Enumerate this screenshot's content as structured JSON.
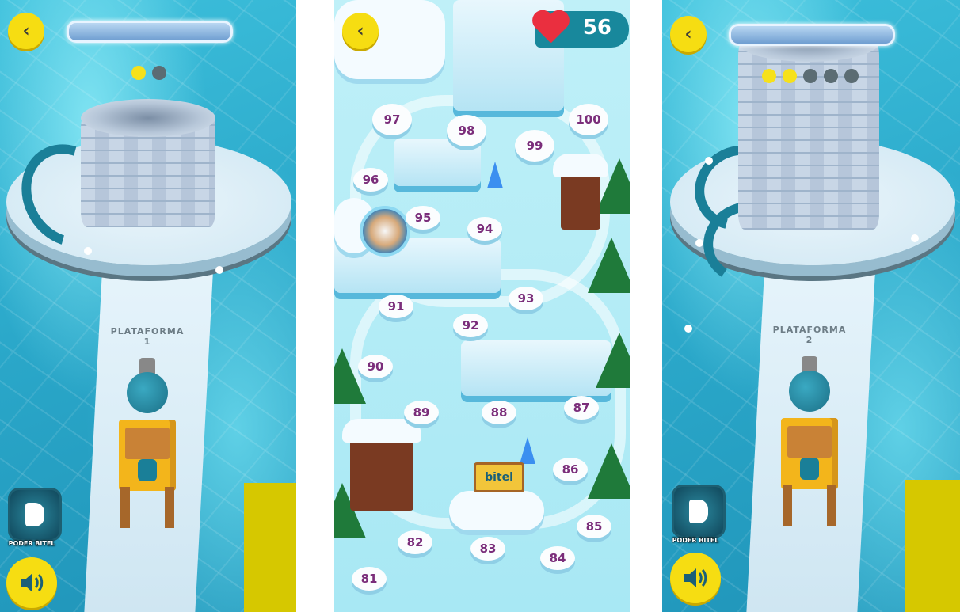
{
  "panels": {
    "left": {
      "platform_label_line1": "PLATAFORMA",
      "platform_label_line2": "1",
      "progress_dots": [
        "on",
        "off"
      ],
      "power_label": "PODER BITEL"
    },
    "middle": {
      "lives": "56",
      "sign_text": "bitel",
      "levels": [
        "100",
        "99",
        "98",
        "97",
        "96",
        "95",
        "94",
        "93",
        "92",
        "91",
        "90",
        "89",
        "88",
        "87",
        "86",
        "85",
        "84",
        "83",
        "82",
        "81"
      ]
    },
    "right": {
      "platform_label_line1": "PLATAFORMA",
      "platform_label_line2": "2",
      "progress_dots": [
        "on",
        "on",
        "off",
        "off",
        "off"
      ],
      "power_label": "PODER BITEL"
    }
  },
  "colors": {
    "accent_yellow": "#f6dd12",
    "water": "#2aa7c9",
    "heart": "#ea2f3f",
    "teal": "#18889c"
  },
  "icons": {
    "back": "chevron-left-icon",
    "sound": "speaker-icon",
    "lives": "heart-icon",
    "power": "bitel-b-icon"
  }
}
